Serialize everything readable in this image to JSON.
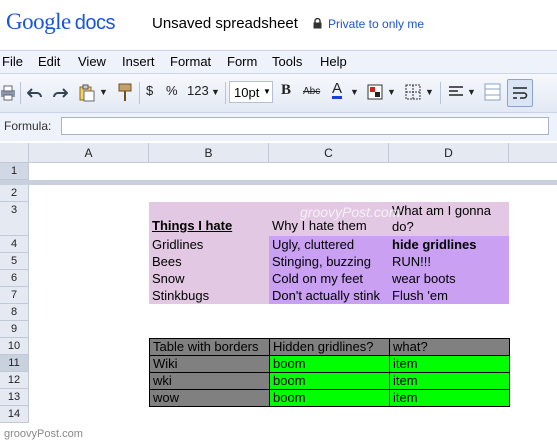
{
  "header": {
    "logo_google": "Google",
    "logo_docs": "docs",
    "title": "Unsaved spreadsheet",
    "privacy": "Private to only me"
  },
  "menu": [
    "File",
    "Edit",
    "View",
    "Insert",
    "Format",
    "Form",
    "Tools",
    "Help"
  ],
  "toolbar": {
    "currency": "$",
    "percent": "%",
    "number_format": "123",
    "font_size": "10pt",
    "bold": "B",
    "strike": "Abc",
    "text_color": "A"
  },
  "formula": {
    "label": "Formula:",
    "value": ""
  },
  "columns": [
    "A",
    "B",
    "C",
    "D"
  ],
  "rows": [
    "1",
    "2",
    "3",
    "4",
    "5",
    "6",
    "7",
    "8",
    "9",
    "10",
    "11",
    "12",
    "13",
    "14"
  ],
  "cells": {
    "b3": "Things I hate",
    "c3": "Why I hate them",
    "d3_line1": "What am I gonna",
    "d3_line2": "do?",
    "b4": "Gridlines",
    "c4": "Ugly, cluttered",
    "d4": "hide gridlines",
    "b5": "Bees",
    "c5": "Stinging, buzzing",
    "d5": "RUN!!!",
    "b6": "Snow",
    "c6": "Cold on my feet",
    "d6": "wear boots",
    "b7": "Stinkbugs",
    "c7": "Don't actually stink",
    "d7": "Flush 'em",
    "b10": "Table with borders",
    "c10": "Hidden gridlines?",
    "d10": "what?",
    "b11": "Wiki",
    "c11": "boom",
    "d11": "item",
    "b12": "wki",
    "c12": "boom",
    "d12": "item",
    "b13": "wow",
    "c13": "boom",
    "d13": "item"
  },
  "watermark": "groovyPost.com",
  "watermark_corner": "groovyPost.com",
  "colors": {
    "pink": "#e2c8e3",
    "purple": "#c9a0f2",
    "gray": "#808080",
    "green": "#00ff00",
    "link_blue": "#1a55d8"
  }
}
